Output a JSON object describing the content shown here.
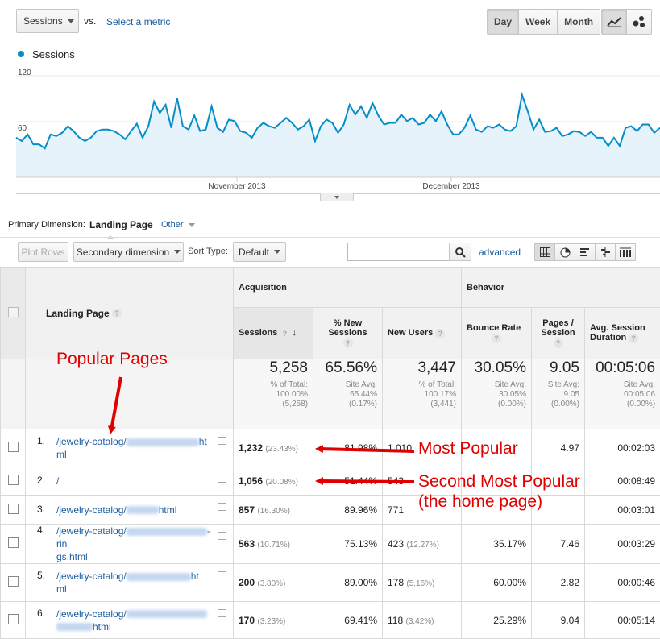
{
  "toolbar": {
    "metric_select": "Sessions",
    "vs_label": "vs.",
    "select_metric_link": "Select a metric",
    "day_label": "Day",
    "week_label": "Week",
    "month_label": "Month"
  },
  "chart": {
    "legend_label": "Sessions",
    "line_color": "#058dc7",
    "fill_color": "#e6f3fa",
    "chart_data": {
      "type": "area",
      "series": [
        {
          "name": "Sessions",
          "values": [
            48,
            44,
            52,
            40,
            40,
            35,
            52,
            50,
            54,
            62,
            56,
            48,
            44,
            48,
            56,
            58,
            58,
            56,
            52,
            46,
            56,
            65,
            48,
            62,
            92,
            78,
            88,
            60,
            96,
            62,
            58,
            75,
            56,
            58,
            86,
            60,
            55,
            70,
            68,
            56,
            54,
            48,
            60,
            66,
            62,
            60,
            66,
            72,
            66,
            58,
            62,
            70,
            44,
            62,
            70,
            66,
            54,
            64,
            88,
            76,
            86,
            72,
            90,
            75,
            64,
            66,
            66,
            76,
            68,
            72,
            64,
            66,
            76,
            68,
            80,
            64,
            52,
            52,
            60,
            75,
            58,
            55,
            62,
            60,
            64,
            58,
            56,
            62,
            100,
            80,
            58,
            70,
            55,
            56,
            60,
            50,
            52,
            56,
            55,
            50,
            55,
            48,
            48,
            38,
            48,
            38,
            60,
            62,
            56,
            64,
            64,
            54,
            60
          ]
        }
      ],
      "ytick_labels": [
        "120",
        "60"
      ],
      "ylim": [
        0,
        130
      ],
      "xtick_labels": [
        "November 2013",
        "December 2013"
      ]
    }
  },
  "dimension": {
    "label": "Primary Dimension:",
    "active": "Landing Page",
    "other": "Other"
  },
  "controls": {
    "plot_rows": "Plot Rows",
    "secondary_dimension": "Secondary dimension",
    "sort_type_label": "Sort Type:",
    "sort_value": "Default",
    "search_placeholder": "",
    "advanced": "advanced"
  },
  "table": {
    "landing_page_header": "Landing Page",
    "group_acquisition": "Acquisition",
    "group_behavior": "Behavior",
    "columns": {
      "sessions": "Sessions",
      "pct_new_sessions": "% New Sessions",
      "new_users": "New Users",
      "bounce_rate": "Bounce Rate",
      "pages_session": "Pages / Session",
      "avg_session_duration": "Avg. Session Duration"
    },
    "totals": {
      "sessions": "5,258",
      "sessions_sub1": "% of Total:",
      "sessions_sub2": "100.00%",
      "sessions_sub3": "(5,258)",
      "pct_new": "65.56%",
      "pct_new_sub1": "Site Avg:",
      "pct_new_sub2": "65.44%",
      "pct_new_sub3": "(0.17%)",
      "new_users": "3,447",
      "new_users_sub1": "% of Total:",
      "new_users_sub2": "100.17%",
      "new_users_sub3": "(3,441)",
      "bounce": "30.05%",
      "bounce_sub1": "Site Avg:",
      "bounce_sub2": "30.05%",
      "bounce_sub3": "(0.00%)",
      "pages": "9.05",
      "pages_sub1": "Site Avg:",
      "pages_sub2": "9.05",
      "pages_sub3": "(0.00%)",
      "duration": "00:05:06",
      "duration_sub1": "Site Avg:",
      "duration_sub2": "00:05:06",
      "duration_sub3": "(0.00%)"
    },
    "rows": [
      {
        "num": "1.",
        "page_a": "/jewelry-catalog/",
        "page_b": "ht",
        "page_c": "ml",
        "sessions": "1,232",
        "sessions_pct": "(23.43%)",
        "pct_new": "81.98%",
        "new_users": "1,010",
        "new_users_pct": "",
        "bounce": "",
        "pages": "4.97",
        "duration": "00:02:03"
      },
      {
        "num": "2.",
        "page_a": "/",
        "page_b": "",
        "page_c": "",
        "sessions": "1,056",
        "sessions_pct": "(20.08%)",
        "pct_new": "51.44%",
        "new_users": "543",
        "new_users_pct": "",
        "bounce": "",
        "pages": "",
        "duration": "00:08:49"
      },
      {
        "num": "3.",
        "page_a": "/jewelry-catalog/",
        "page_b": "html",
        "page_c": "",
        "sessions": "857",
        "sessions_pct": "(16.30%)",
        "pct_new": "89.96%",
        "new_users": "771",
        "new_users_pct": "",
        "bounce": "",
        "pages": "",
        "duration": "00:03:01"
      },
      {
        "num": "4.",
        "page_a": "/jewelry-catalog/",
        "page_b": "-rin",
        "page_c": "gs.html",
        "sessions": "563",
        "sessions_pct": "(10.71%)",
        "pct_new": "75.13%",
        "new_users": "423",
        "new_users_pct": "(12.27%)",
        "bounce": "35.17%",
        "pages": "7.46",
        "duration": "00:03:29"
      },
      {
        "num": "5.",
        "page_a": "/jewelry-catalog/",
        "page_b": "ht",
        "page_c": "ml",
        "sessions": "200",
        "sessions_pct": "(3.80%)",
        "pct_new": "89.00%",
        "new_users": "178",
        "new_users_pct": "(5.16%)",
        "bounce": "60.00%",
        "pages": "2.82",
        "duration": "00:00:46"
      },
      {
        "num": "6.",
        "page_a": "/jewelry-catalog/",
        "page_b": "",
        "page_c": "html",
        "sessions": "170",
        "sessions_pct": "(3.23%)",
        "pct_new": "69.41%",
        "new_users": "118",
        "new_users_pct": "(3.42%)",
        "bounce": "25.29%",
        "pages": "9.04",
        "duration": "00:05:14"
      }
    ]
  },
  "annotations": {
    "popular_pages": "Popular Pages",
    "most_popular": "Most Popular",
    "second_most_line1": "Second Most Popular",
    "second_most_line2": "(the home page)",
    "arrow_color": "#e00000"
  },
  "icons": [
    "line-chart-icon",
    "motion-chart-icon",
    "search-icon",
    "table-view-icon",
    "pie-view-icon",
    "bar-view-icon",
    "comparison-view-icon",
    "pivot-view-icon",
    "external-link-icon",
    "help-icon",
    "sort-down-icon"
  ]
}
